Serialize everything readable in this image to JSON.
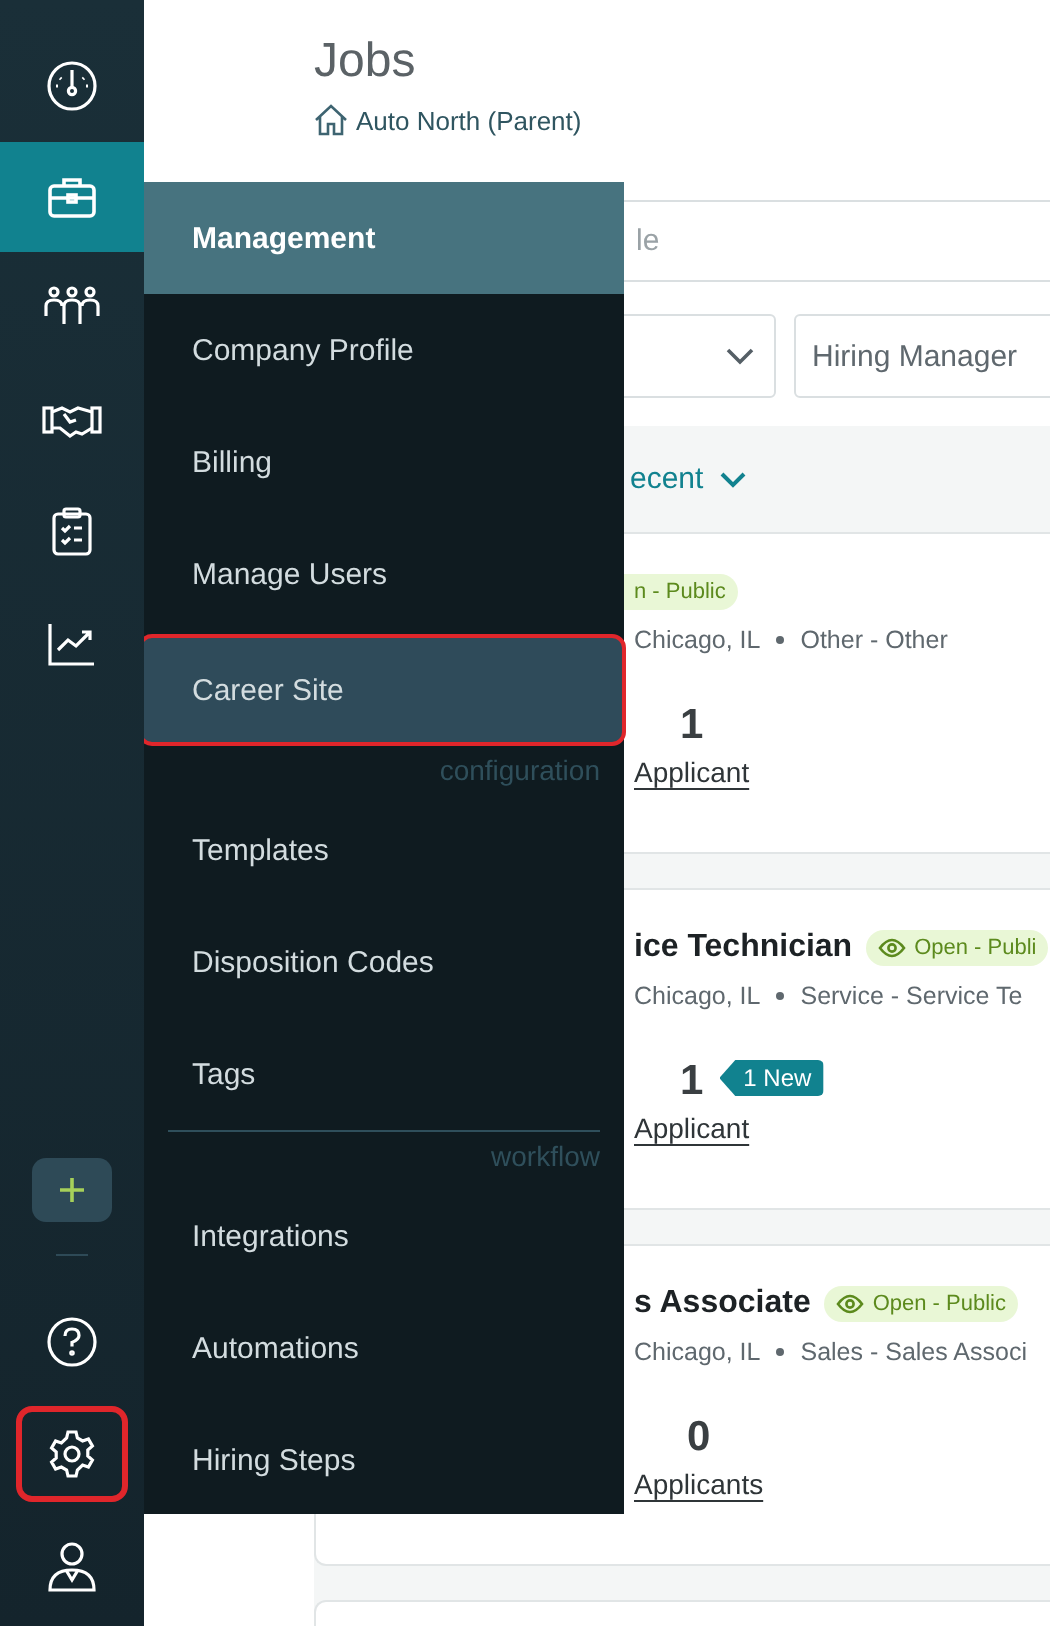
{
  "sidebar": {
    "items": [
      {
        "selected": false
      },
      {
        "selected": true
      },
      {
        "selected": false
      },
      {
        "selected": false
      },
      {
        "selected": false
      },
      {
        "selected": false
      }
    ],
    "bottom_items": [
      {
        "highlighted": false
      },
      {
        "highlighted": true
      },
      {
        "highlighted": false
      }
    ]
  },
  "page": {
    "title": "Jobs",
    "breadcrumb": "Auto North (Parent)"
  },
  "search": {
    "placeholder": "le"
  },
  "filters": {
    "second": {
      "placeholder": "Hiring Manager"
    }
  },
  "sort": {
    "label": "ecent"
  },
  "jobs": [
    {
      "status": "n - Public",
      "eye": false,
      "location": "Chicago, IL",
      "department": "Other - Other",
      "count": "1",
      "count_label": "Applicant"
    },
    {
      "title": "ice Technician",
      "status": "Open - Publi",
      "eye": true,
      "location": "Chicago, IL",
      "department": "Service - Service Te",
      "count": "1",
      "new_badge": "1 New",
      "count_label": "Applicant"
    },
    {
      "title": "s Associate",
      "status": "Open - Public",
      "eye": true,
      "location": "Chicago, IL",
      "department": "Sales - Sales Associ",
      "count": "0",
      "count_label": "Applicants"
    }
  ],
  "menu": {
    "header": {
      "label": "Management",
      "selected": true
    },
    "sections": [
      {
        "divider": false,
        "items": [
          {
            "label": "Company Profile",
            "selected": false,
            "highlighted": false
          },
          {
            "label": "Billing",
            "selected": false,
            "highlighted": false
          },
          {
            "label": "Manage Users",
            "selected": false,
            "highlighted": false
          },
          {
            "label": "Career Site",
            "selected": false,
            "highlighted": true
          }
        ]
      },
      {
        "label": "configuration",
        "divider": false,
        "items": [
          {
            "label": "Templates",
            "selected": false,
            "highlighted": false
          },
          {
            "label": "Disposition Codes",
            "selected": false,
            "highlighted": false
          },
          {
            "label": "Tags",
            "selected": false,
            "highlighted": false
          }
        ]
      },
      {
        "label": "workflow",
        "divider": true,
        "items": [
          {
            "label": "Integrations",
            "selected": false,
            "highlighted": false
          },
          {
            "label": "Automations",
            "selected": false,
            "highlighted": false
          },
          {
            "label": "Hiring Steps",
            "selected": false,
            "highlighted": false
          }
        ]
      }
    ]
  }
}
